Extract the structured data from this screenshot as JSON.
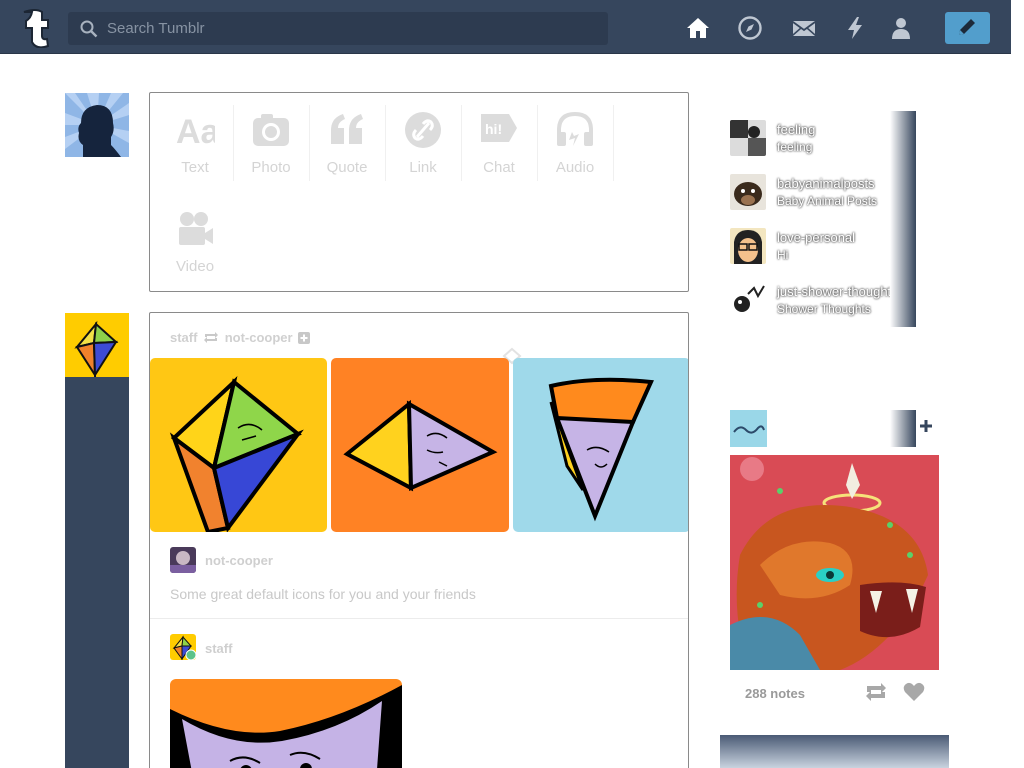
{
  "header": {
    "search_placeholder": "Search Tumblr",
    "nav_icons": [
      "home-icon",
      "compass-icon",
      "mail-icon",
      "lightning-icon",
      "person-icon"
    ],
    "compose_icon": "pencil-icon",
    "colors": {
      "bar": "#36465d",
      "accent": "#529ecc"
    }
  },
  "composer": {
    "types": [
      {
        "label": "Text",
        "icon": "text-aa-icon"
      },
      {
        "label": "Photo",
        "icon": "camera-icon"
      },
      {
        "label": "Quote",
        "icon": "quote-icon"
      },
      {
        "label": "Link",
        "icon": "link-icon"
      },
      {
        "label": "Chat",
        "icon": "chat-icon"
      },
      {
        "label": "Audio",
        "icon": "headphones-icon"
      },
      {
        "label": "Video",
        "icon": "video-camera-icon"
      }
    ]
  },
  "post": {
    "author": "staff",
    "reblogged_from": "not-cooper",
    "reblog_author": "not-cooper",
    "caption": "Some great default icons for you and your friends",
    "second_author": "staff"
  },
  "recommended": [
    {
      "name": "feeling",
      "title": "feeling"
    },
    {
      "name": "babyanimalposts",
      "title": "Baby Animal Posts"
    },
    {
      "name": "love-personal",
      "title": "Hi"
    },
    {
      "name": "just-shower-thoughts",
      "title": "Shower Thoughts"
    }
  ],
  "radar": {
    "notes": "288 notes"
  }
}
